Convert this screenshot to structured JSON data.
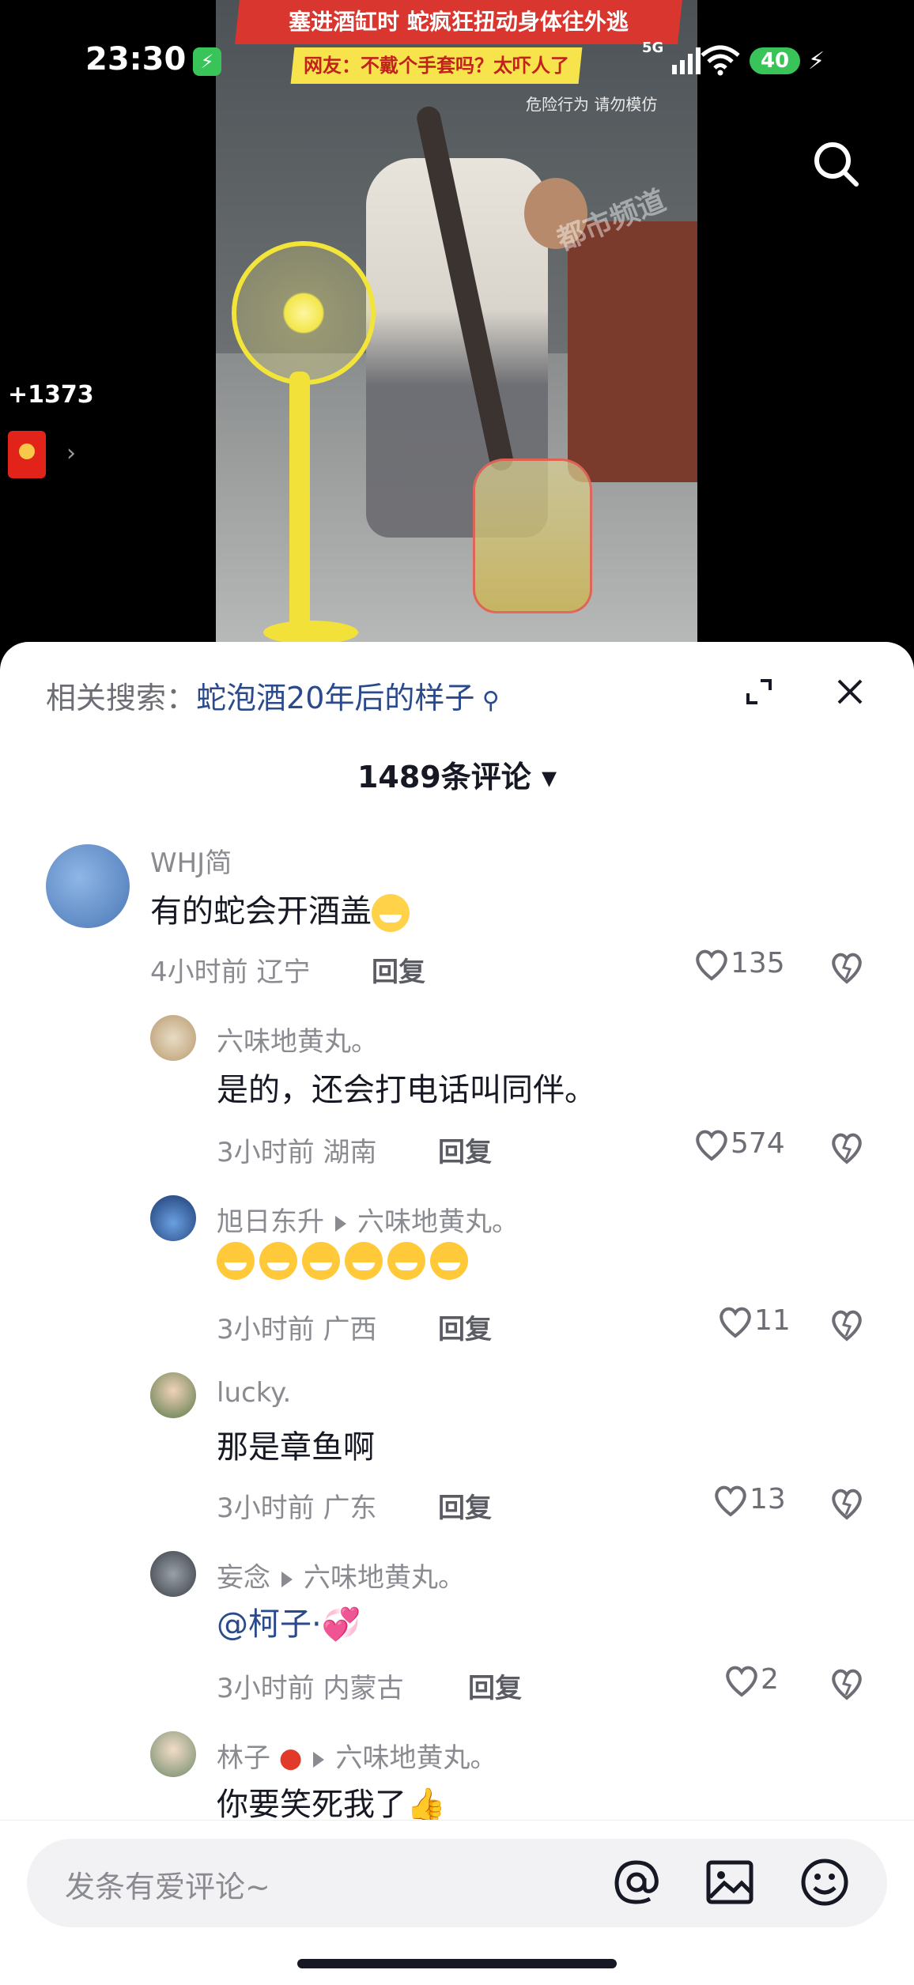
{
  "status_bar": {
    "time": "23:30",
    "network": "5G",
    "battery": "40"
  },
  "video": {
    "headline": "塞进酒缸时 蛇疯狂扭动身体往外逃",
    "subheadline": "网友：不戴个手套吗？太吓人了",
    "warning": "危险行为 请勿模仿",
    "watermark": "都市频道"
  },
  "side": {
    "coins": "+1373"
  },
  "sheet": {
    "related_label": "相关搜索：",
    "related_query": "蛇泡酒20年后的样子",
    "comment_count": "1489条评论"
  },
  "comments": [
    {
      "user": "WHJ简",
      "text": "有的蛇会开酒盖",
      "time": "4小时前 辽宁",
      "reply": "回复",
      "likes": "135"
    },
    {
      "user": "六味地黄丸。",
      "text": "是的，还会打电话叫同伴。",
      "time": "3小时前 湖南",
      "reply": "回复",
      "likes": "574"
    },
    {
      "user": "旭日东升",
      "reply_to": "六味地黄丸。",
      "time": "3小时前 广西",
      "reply": "回复",
      "likes": "11"
    },
    {
      "user": "lucky.",
      "text": "那是章鱼啊",
      "time": "3小时前 广东",
      "reply": "回复",
      "likes": "13"
    },
    {
      "user": "妄念",
      "reply_to": "六味地黄丸。",
      "text": "@柯子·",
      "time": "3小时前 内蒙古",
      "reply": "回复",
      "likes": "2"
    },
    {
      "user": "林子",
      "reply_to": "六味地黄丸。",
      "text": "你要笑死我了"
    }
  ],
  "input": {
    "placeholder": "发条有爱评论~"
  }
}
